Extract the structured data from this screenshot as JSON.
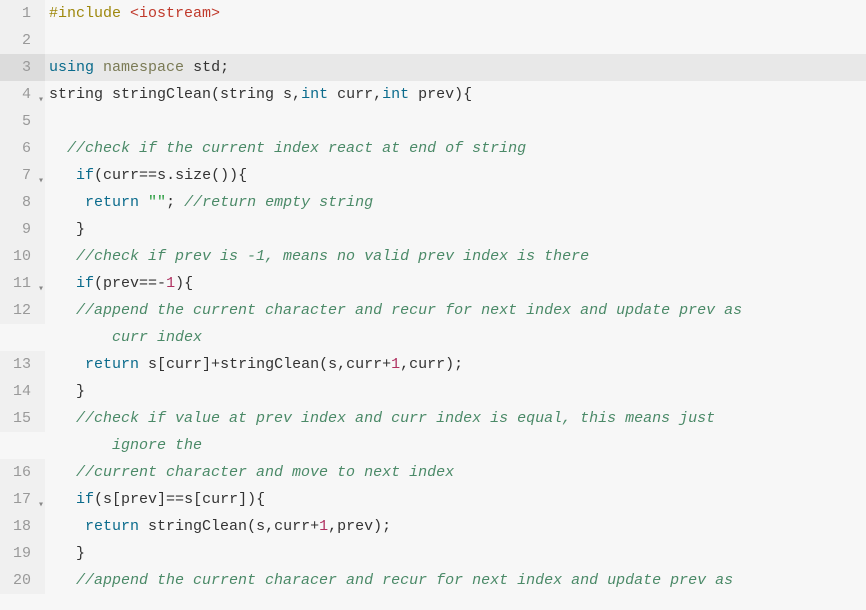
{
  "lines": [
    {
      "num": "1",
      "fold": false,
      "highlight": false,
      "tokens": [
        {
          "cls": "tok-preproc",
          "t": "#include "
        },
        {
          "cls": "tok-include-path",
          "t": "<iostream>"
        }
      ],
      "wrap": null
    },
    {
      "num": "2",
      "fold": false,
      "highlight": false,
      "tokens": [],
      "wrap": null
    },
    {
      "num": "3",
      "fold": false,
      "highlight": true,
      "tokens": [
        {
          "cls": "tok-keyword",
          "t": "using"
        },
        {
          "cls": "tok-punc",
          "t": " "
        },
        {
          "cls": "tok-keyword2",
          "t": "namespace"
        },
        {
          "cls": "tok-punc",
          "t": " "
        },
        {
          "cls": "tok-ident",
          "t": "std"
        },
        {
          "cls": "tok-punc",
          "t": ";"
        }
      ],
      "wrap": null
    },
    {
      "num": "4",
      "fold": true,
      "highlight": false,
      "tokens": [
        {
          "cls": "tok-ident",
          "t": "string "
        },
        {
          "cls": "tok-func",
          "t": "stringClean"
        },
        {
          "cls": "tok-punc",
          "t": "(string s,"
        },
        {
          "cls": "tok-type",
          "t": "int"
        },
        {
          "cls": "tok-punc",
          "t": " curr,"
        },
        {
          "cls": "tok-type",
          "t": "int"
        },
        {
          "cls": "tok-punc",
          "t": " prev){"
        }
      ],
      "wrap": null
    },
    {
      "num": "5",
      "fold": false,
      "highlight": false,
      "tokens": [],
      "wrap": null
    },
    {
      "num": "6",
      "fold": false,
      "highlight": false,
      "tokens": [
        {
          "cls": "tok-punc",
          "t": "  "
        },
        {
          "cls": "tok-comment",
          "t": "//check if the current index react at end of string"
        }
      ],
      "wrap": null
    },
    {
      "num": "7",
      "fold": true,
      "highlight": false,
      "tokens": [
        {
          "cls": "tok-punc",
          "t": "   "
        },
        {
          "cls": "tok-keyword",
          "t": "if"
        },
        {
          "cls": "tok-punc",
          "t": "(curr"
        },
        {
          "cls": "tok-punc",
          "t": "=="
        },
        {
          "cls": "tok-punc",
          "t": "s.size()){"
        }
      ],
      "wrap": null
    },
    {
      "num": "8",
      "fold": false,
      "highlight": false,
      "tokens": [
        {
          "cls": "tok-punc",
          "t": "    "
        },
        {
          "cls": "tok-keyword",
          "t": "return"
        },
        {
          "cls": "tok-punc",
          "t": " "
        },
        {
          "cls": "tok-string",
          "t": "\"\""
        },
        {
          "cls": "tok-punc",
          "t": "; "
        },
        {
          "cls": "tok-comment",
          "t": "//return empty string"
        }
      ],
      "wrap": null
    },
    {
      "num": "9",
      "fold": false,
      "highlight": false,
      "tokens": [
        {
          "cls": "tok-punc",
          "t": "   }"
        }
      ],
      "wrap": null
    },
    {
      "num": "10",
      "fold": false,
      "highlight": false,
      "tokens": [
        {
          "cls": "tok-punc",
          "t": "   "
        },
        {
          "cls": "tok-comment",
          "t": "//check if prev is -1, means no valid prev index is there"
        }
      ],
      "wrap": null
    },
    {
      "num": "11",
      "fold": true,
      "highlight": false,
      "tokens": [
        {
          "cls": "tok-punc",
          "t": "   "
        },
        {
          "cls": "tok-keyword",
          "t": "if"
        },
        {
          "cls": "tok-punc",
          "t": "(prev"
        },
        {
          "cls": "tok-punc",
          "t": "==-"
        },
        {
          "cls": "tok-number",
          "t": "1"
        },
        {
          "cls": "tok-punc",
          "t": "){"
        }
      ],
      "wrap": null
    },
    {
      "num": "12",
      "fold": false,
      "highlight": false,
      "tokens": [
        {
          "cls": "tok-punc",
          "t": "   "
        },
        {
          "cls": "tok-comment",
          "t": "//append the current character and recur for next index and update prev as"
        }
      ],
      "wrap": {
        "indent": "       ",
        "cls": "tok-comment",
        "t": "curr index"
      }
    },
    {
      "num": "13",
      "fold": false,
      "highlight": false,
      "tokens": [
        {
          "cls": "tok-punc",
          "t": "    "
        },
        {
          "cls": "tok-keyword",
          "t": "return"
        },
        {
          "cls": "tok-punc",
          "t": " s[curr]"
        },
        {
          "cls": "tok-punc",
          "t": "+"
        },
        {
          "cls": "tok-func",
          "t": "stringClean"
        },
        {
          "cls": "tok-punc",
          "t": "(s,curr"
        },
        {
          "cls": "tok-punc",
          "t": "+"
        },
        {
          "cls": "tok-number",
          "t": "1"
        },
        {
          "cls": "tok-punc",
          "t": ",curr);"
        }
      ],
      "wrap": null
    },
    {
      "num": "14",
      "fold": false,
      "highlight": false,
      "tokens": [
        {
          "cls": "tok-punc",
          "t": "   }"
        }
      ],
      "wrap": null
    },
    {
      "num": "15",
      "fold": false,
      "highlight": false,
      "tokens": [
        {
          "cls": "tok-punc",
          "t": "   "
        },
        {
          "cls": "tok-comment",
          "t": "//check if value at prev index and curr index is equal, this means just"
        }
      ],
      "wrap": {
        "indent": "       ",
        "cls": "tok-comment",
        "t": "ignore the"
      }
    },
    {
      "num": "16",
      "fold": false,
      "highlight": false,
      "tokens": [
        {
          "cls": "tok-punc",
          "t": "   "
        },
        {
          "cls": "tok-comment",
          "t": "//current character and move to next index"
        }
      ],
      "wrap": null
    },
    {
      "num": "17",
      "fold": true,
      "highlight": false,
      "tokens": [
        {
          "cls": "tok-punc",
          "t": "   "
        },
        {
          "cls": "tok-keyword",
          "t": "if"
        },
        {
          "cls": "tok-punc",
          "t": "(s[prev]"
        },
        {
          "cls": "tok-punc",
          "t": "=="
        },
        {
          "cls": "tok-punc",
          "t": "s[curr]){"
        }
      ],
      "wrap": null
    },
    {
      "num": "18",
      "fold": false,
      "highlight": false,
      "tokens": [
        {
          "cls": "tok-punc",
          "t": "    "
        },
        {
          "cls": "tok-keyword",
          "t": "return"
        },
        {
          "cls": "tok-punc",
          "t": " "
        },
        {
          "cls": "tok-func",
          "t": "stringClean"
        },
        {
          "cls": "tok-punc",
          "t": "(s,curr"
        },
        {
          "cls": "tok-punc",
          "t": "+"
        },
        {
          "cls": "tok-number",
          "t": "1"
        },
        {
          "cls": "tok-punc",
          "t": ",prev);"
        }
      ],
      "wrap": null
    },
    {
      "num": "19",
      "fold": false,
      "highlight": false,
      "tokens": [
        {
          "cls": "tok-punc",
          "t": "   }"
        }
      ],
      "wrap": null
    },
    {
      "num": "20",
      "fold": false,
      "highlight": false,
      "tokens": [
        {
          "cls": "tok-punc",
          "t": "   "
        },
        {
          "cls": "tok-comment",
          "t": "//append the current characer and recur for next index and update prev as"
        }
      ],
      "wrap": null
    }
  ]
}
